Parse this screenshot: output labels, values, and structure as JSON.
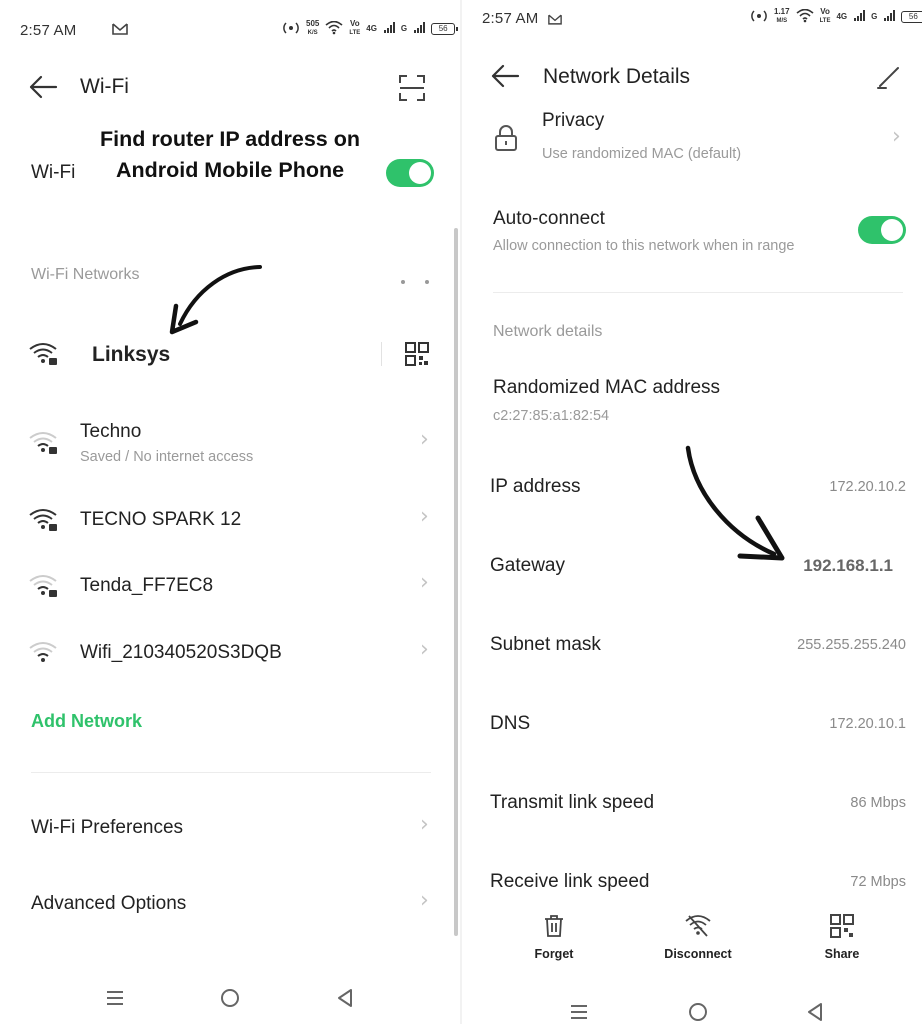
{
  "left": {
    "status": {
      "time": "2:57 AM",
      "speed_top": "505",
      "speed_unit": "K/S",
      "volte_top": "Vo",
      "volte_bottom": "LTE",
      "network": "4G",
      "network2": "G",
      "battery": "56"
    },
    "header": {
      "title": "Wi-Fi"
    },
    "annotation": {
      "line1": "Find router IP address on",
      "line2": "Android Mobile Phone"
    },
    "wifi_toggle_label": "Wi-Fi",
    "section_networks": "Wi-Fi Networks",
    "connected_network": "Linksys",
    "networks": [
      {
        "name": "Techno",
        "status": "Saved / No internet access"
      },
      {
        "name": "TECNO SPARK 12"
      },
      {
        "name": "Tenda_FF7EC8"
      },
      {
        "name": "Wifi_210340520S3DQB"
      }
    ],
    "add_network": "Add Network",
    "menu": [
      {
        "label": "Wi-Fi Preferences"
      },
      {
        "label": "Advanced Options"
      }
    ]
  },
  "right": {
    "status": {
      "time": "2:57 AM",
      "speed_top": "1.17",
      "speed_unit": "M/S",
      "volte_top": "Vo",
      "volte_bottom": "LTE",
      "network": "4G",
      "network2": "G",
      "battery": "56"
    },
    "header": {
      "title": "Network Details"
    },
    "privacy": {
      "title": "Privacy",
      "sub": "Use randomized MAC (default)"
    },
    "auto_connect": {
      "title": "Auto-connect",
      "sub": "Allow connection to this network when in range"
    },
    "section_details": "Network details",
    "mac": {
      "label": "Randomized MAC address",
      "value": "c2:27:85:a1:82:54"
    },
    "details": [
      {
        "label": "IP address",
        "value": "172.20.10.2"
      },
      {
        "label": "Gateway",
        "value": "192.168.1.1"
      },
      {
        "label": "Subnet mask",
        "value": "255.255.255.240"
      },
      {
        "label": "DNS",
        "value": "172.20.10.1"
      },
      {
        "label": "Transmit link speed",
        "value": "86 Mbps"
      },
      {
        "label": "Receive link speed",
        "value": "72 Mbps"
      }
    ],
    "actions": [
      {
        "label": "Forget"
      },
      {
        "label": "Disconnect"
      },
      {
        "label": "Share"
      }
    ]
  },
  "colors": {
    "accent_green": "#2fc26b",
    "text_primary": "#222222",
    "text_secondary": "#9a9a9a"
  }
}
